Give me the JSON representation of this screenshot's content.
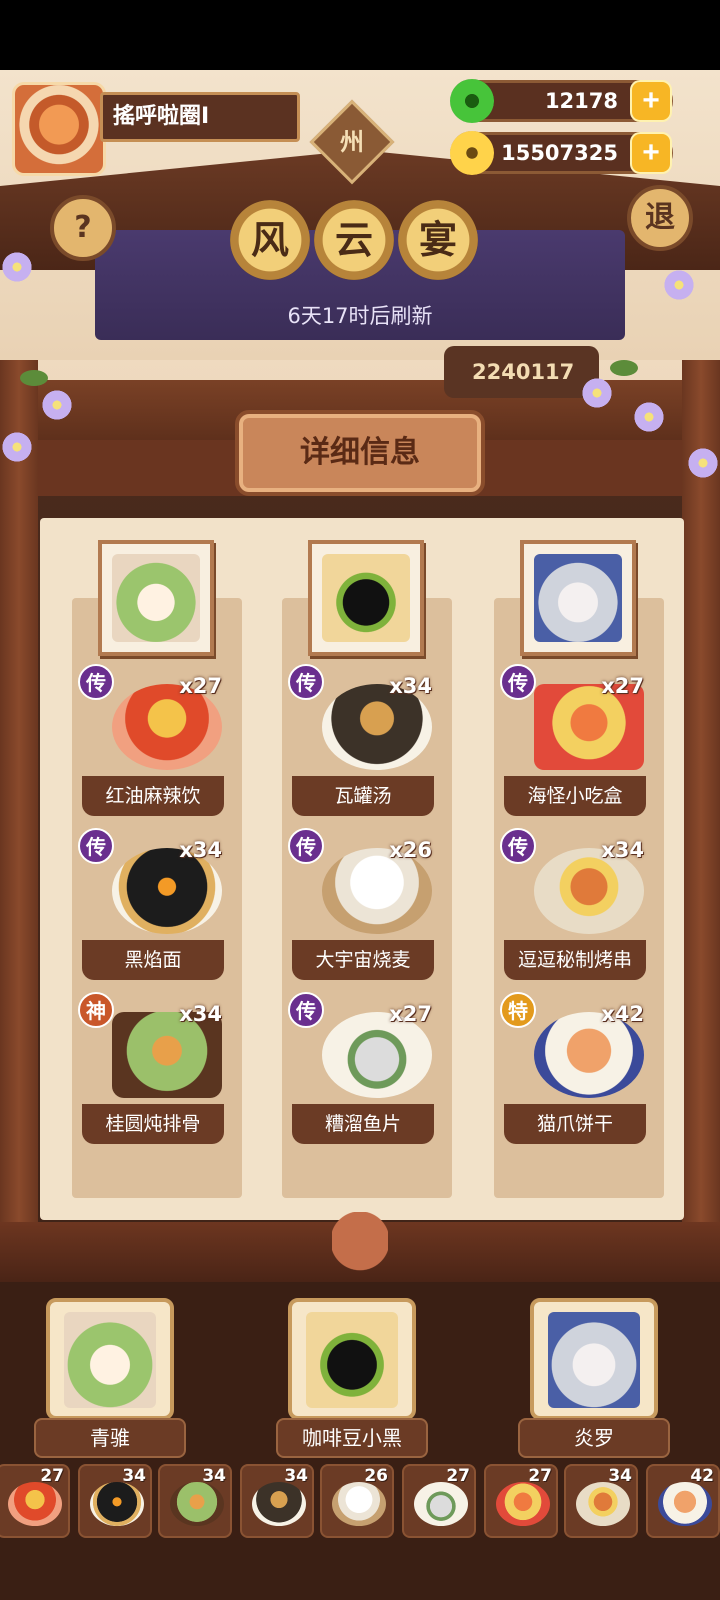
{
  "player": {
    "name": "搖呼啦圈I",
    "province": "州"
  },
  "currency": {
    "jade": "12178",
    "coins": "15507325"
  },
  "buttons": {
    "help": "?",
    "exit": "退",
    "add": "+"
  },
  "event": {
    "title_chars": [
      "风",
      "云",
      "宴"
    ],
    "refresh_text": "6天17时后刷新",
    "score": "2240117"
  },
  "section_title": "详细信息",
  "columns": [
    {
      "chef": "青骓",
      "dishes": [
        {
          "name": "红油麻辣饮",
          "count": "x27",
          "grade": "传",
          "grade_color": "#6a2f8e"
        },
        {
          "name": "黑焰面",
          "count": "x34",
          "grade": "传",
          "grade_color": "#6a2f8e"
        },
        {
          "name": "桂圆炖排骨",
          "count": "x34",
          "grade": "神",
          "grade_color": "#c9572a"
        }
      ]
    },
    {
      "chef": "咖啡豆小黑",
      "dishes": [
        {
          "name": "瓦罐汤",
          "count": "x34",
          "grade": "传",
          "grade_color": "#6a2f8e"
        },
        {
          "name": "大宇宙烧麦",
          "count": "x26",
          "grade": "传",
          "grade_color": "#6a2f8e"
        },
        {
          "name": "糟溜鱼片",
          "count": "x27",
          "grade": "传",
          "grade_color": "#6a2f8e"
        }
      ]
    },
    {
      "chef": "炎罗",
      "dishes": [
        {
          "name": "海怪小吃盒",
          "count": "x27",
          "grade": "传",
          "grade_color": "#6a2f8e"
        },
        {
          "name": "逗逗秘制烤串",
          "count": "x34",
          "grade": "传",
          "grade_color": "#6a2f8e"
        },
        {
          "name": "猫爪饼干",
          "count": "x42",
          "grade": "特",
          "grade_color": "#e39a1c"
        }
      ]
    }
  ],
  "tray": [
    "27",
    "34",
    "34",
    "34",
    "26",
    "27",
    "27",
    "34",
    "42"
  ]
}
